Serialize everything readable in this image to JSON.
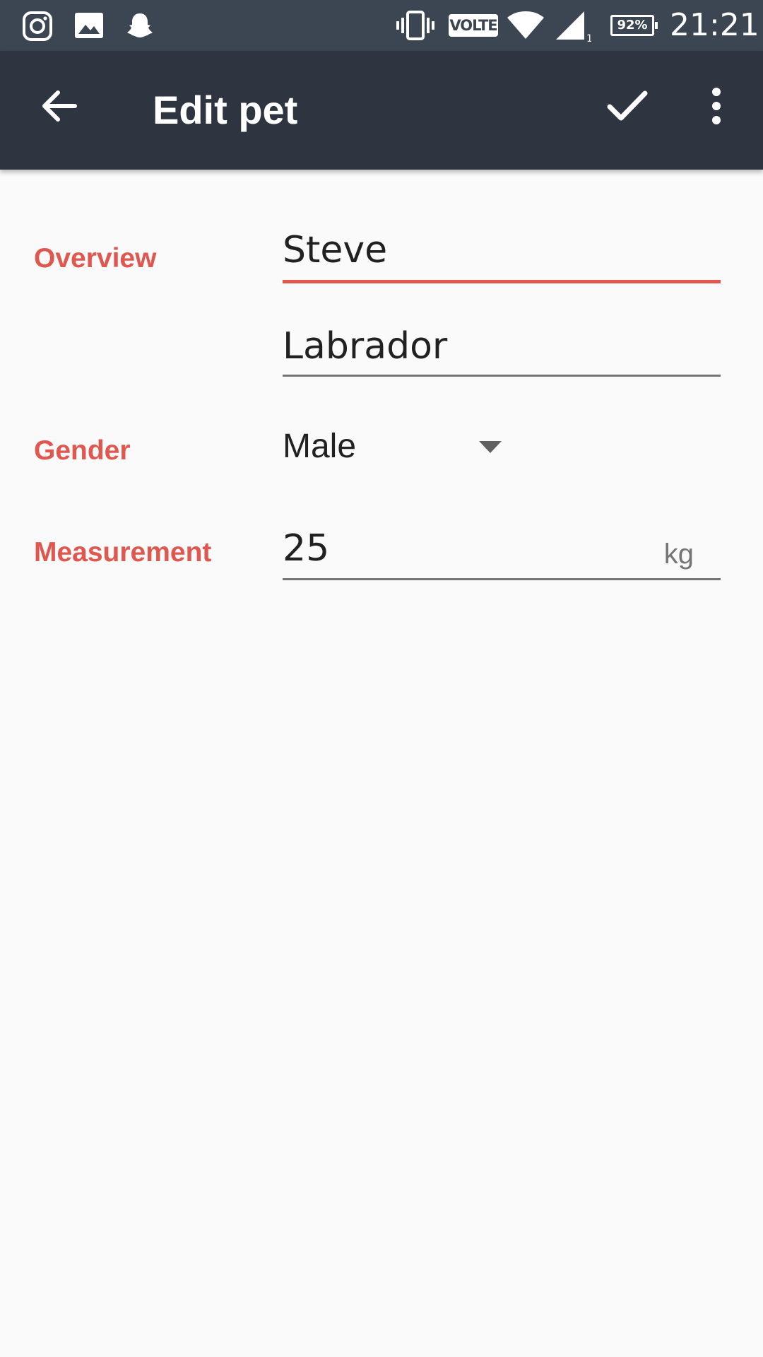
{
  "status_bar": {
    "left_icons": [
      "instagram-icon",
      "gallery-icon",
      "snapchat-icon"
    ],
    "right_icons": [
      "vibrate-icon",
      "volte-badge",
      "wifi-icon",
      "signal-icon",
      "battery-icon"
    ],
    "volte_label": "VOLTE",
    "battery_level": "92%",
    "signal_sub_label": "1",
    "time": "21:21"
  },
  "app_bar": {
    "title": "Edit pet",
    "back_icon": "arrow-back-icon",
    "save_icon": "check-icon",
    "more_icon": "more-vert-icon"
  },
  "form": {
    "overview": {
      "label": "Overview",
      "name_value": "Steve",
      "breed_value": "Labrador"
    },
    "gender": {
      "label": "Gender",
      "selected": "Male"
    },
    "measurement": {
      "label": "Measurement",
      "value": "25",
      "unit": "kg"
    }
  },
  "colors": {
    "status_bar_bg": "#3C4552",
    "app_bar_bg": "#2E3440",
    "accent": "#E0574F",
    "background": "#FAFAFA",
    "text_primary": "#212121",
    "underline": "#757575"
  }
}
